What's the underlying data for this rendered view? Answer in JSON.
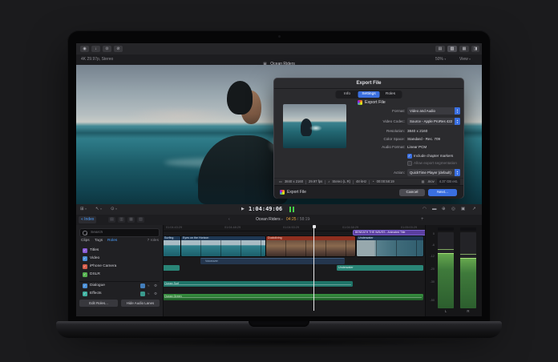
{
  "viewer": {
    "tb_left": [
      "◉",
      "↓",
      "⊙",
      "⊘"
    ],
    "tb_right": [
      "▤",
      "▥",
      "▦",
      "◨"
    ],
    "format_info": "4K 29.97p, Stereo",
    "project_icon": "▣",
    "project_title": "Ocean Riders",
    "zoom": "50%",
    "view": "View",
    "caret": "▾"
  },
  "dlg": {
    "title": "Export File",
    "tabs": [
      "Info",
      "Settings",
      "Roles"
    ],
    "app_icon_label": "Export File",
    "fields": [
      {
        "label": "Format:",
        "value": "Video and Audio"
      },
      {
        "label": "Video Codec:",
        "value": "Source - Apple ProRes 422"
      },
      {
        "label": "Resolution:",
        "value": "3840 x 2160"
      },
      {
        "label": "Color Space:",
        "value": "Standard - Rec. 709"
      },
      {
        "label": "Audio Format:",
        "value": "Linear PCM"
      }
    ],
    "checks": [
      {
        "label": "Include chapter markers"
      },
      {
        "label": "Allow export segmentation"
      }
    ],
    "check_glyph": "✓",
    "action": {
      "label": "Action:",
      "value": "QuickTime Player (default)"
    },
    "caret_up": "▴",
    "caret_down": "▾",
    "summary": {
      "res_icon": "▭",
      "res": "3840 x 2160",
      "fps": "29.97 fps",
      "audio_icon": "♪",
      "audio": "Stereo (L R)",
      "rate": "48 kHz",
      "dur_icon": "◔",
      "dur": "00:00:58:19",
      "file_icon": "▤",
      "ext": ".mov",
      "size": "4.37 GB est."
    },
    "footer": {
      "label": "Export File",
      "cancel": "Cancel",
      "next": "Next..."
    },
    "accent": "#3a6fe0"
  },
  "tl": {
    "tools": [
      "⊞",
      "↖",
      "⊙"
    ],
    "tool_caret": "▾",
    "play": "▶",
    "timecode": "1:04:49:06",
    "right_icons": [
      "◠",
      "▬",
      "⊕",
      "◎",
      "▣",
      "↗"
    ],
    "index_icon": "«",
    "index": "Index",
    "lane_icons": [
      "▤",
      "▥",
      "▦",
      "▧"
    ],
    "nav": {
      "prev": "‹",
      "project": "Ocean Riders",
      "caret": "▾",
      "current": "04:25",
      "sep": "/",
      "total": "58:19",
      "next": "›",
      "add": "+"
    },
    "search_placeholder": "Search",
    "tabs": {
      "clips": "Clips",
      "tags": "Tags",
      "roles": "Roles",
      "count": "7 roles"
    },
    "roles": [
      {
        "name": "Titles",
        "swatch": "background:#8a5cd6"
      },
      {
        "name": "Video",
        "swatch": "background:#4a8fd6"
      },
      {
        "name": "iPhone Camera",
        "swatch": "background:#d65c4a"
      },
      {
        "name": "DSLR",
        "swatch": "background:#55b04f"
      },
      {
        "name": "Dialogue",
        "swatch": "background:#4a8fd6"
      },
      {
        "name": "Effects",
        "swatch": "background:#3fb0a0"
      }
    ],
    "role_icon_wave": "≈",
    "role_icon_gear": "⚙",
    "buttons": {
      "edit_roles": "Edit Roles...",
      "hide_lanes": "Hide Audio Lanes"
    },
    "ruler": [
      "01:04:43:29",
      "01:04:48:29",
      "01:04:53:29",
      "01:04:58:29",
      "01:05:03:29"
    ],
    "clips": {
      "title_clip": "BENEATH THE WAVES - Animated Title",
      "video": [
        {
          "name": "Surfing"
        },
        {
          "name": "Eyes on the Horizon"
        },
        {
          "name": "Duckdiving"
        },
        {
          "name": "Underwater"
        }
      ],
      "voiceover": "Voiceover",
      "underwater_audio": "Underwater",
      "surf": "Ocean Surf",
      "music": "Ocean Green"
    },
    "meters": {
      "scale": [
        "0",
        "-6",
        "-12",
        "-20",
        "-30",
        "-50"
      ],
      "left": "L",
      "right": "R"
    }
  }
}
